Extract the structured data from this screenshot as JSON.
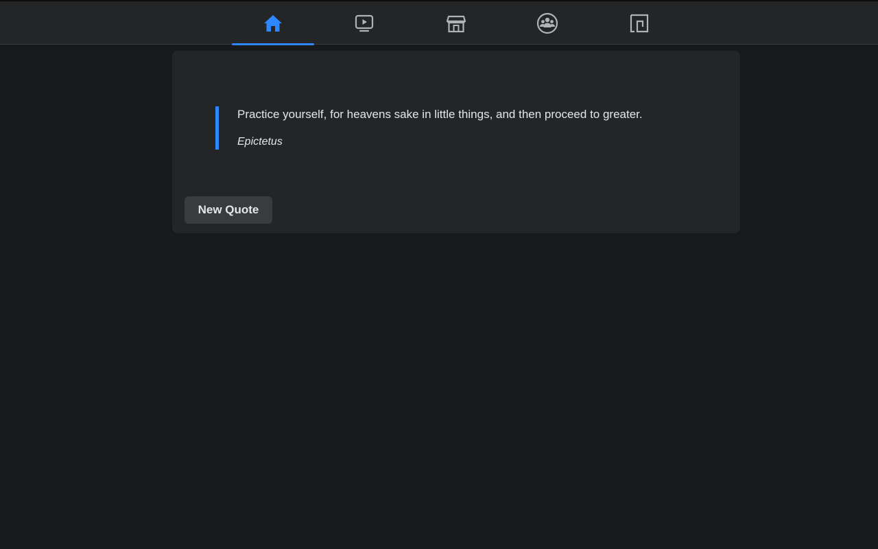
{
  "nav": {
    "tabs": [
      {
        "icon": "home-icon",
        "active": true
      },
      {
        "icon": "watch-video-icon",
        "active": false
      },
      {
        "icon": "marketplace-store-icon",
        "active": false
      },
      {
        "icon": "groups-icon",
        "active": false
      },
      {
        "icon": "gaming-icon",
        "active": false
      }
    ]
  },
  "quote": {
    "text": "Practice yourself, for heavens sake in little things, and then proceed to greater.",
    "author": "Epictetus"
  },
  "actions": {
    "new_quote_label": "New Quote"
  },
  "colors": {
    "accent": "#2d88ff",
    "background": "#18191a",
    "surface": "#242526",
    "button": "#3a3b3c",
    "icon_inactive": "#b0b3b8",
    "text": "#e4e6eb"
  }
}
